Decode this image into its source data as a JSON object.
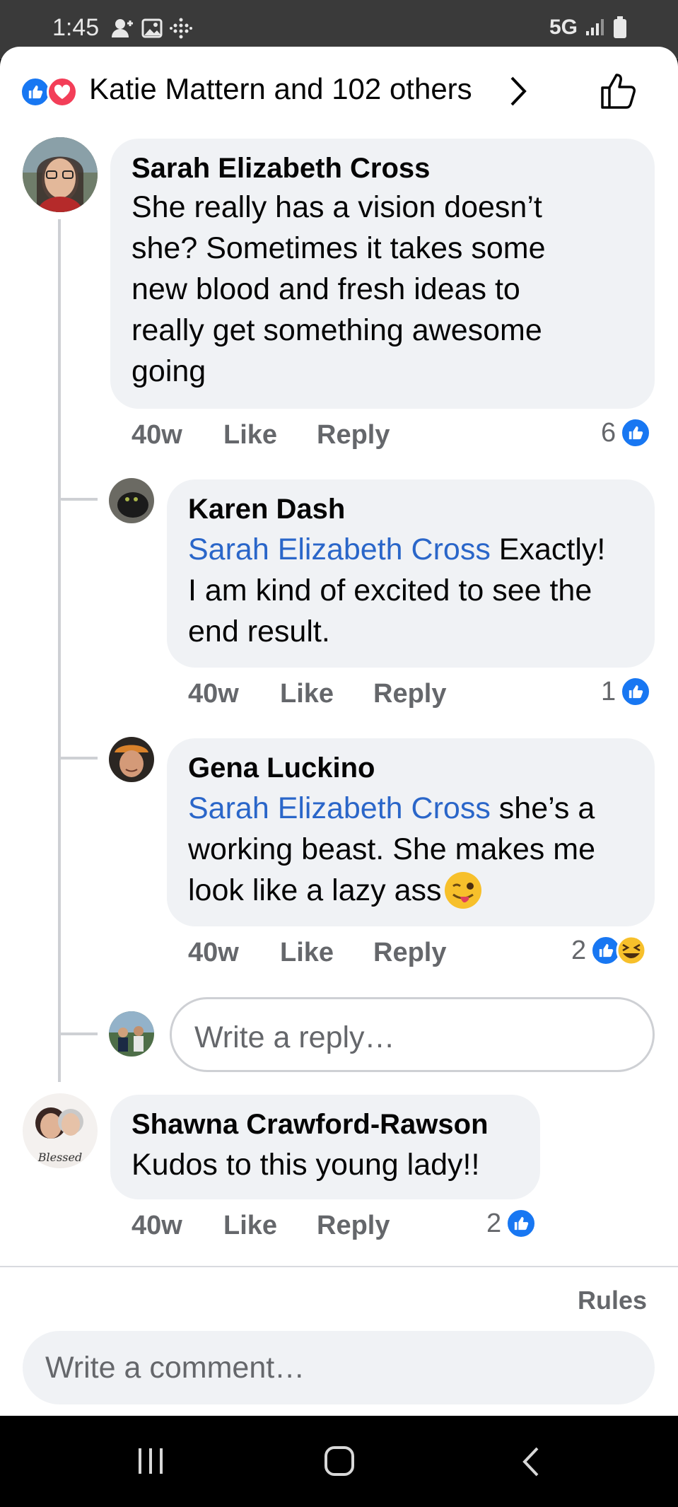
{
  "status_bar": {
    "time": "1:45",
    "network": "5G"
  },
  "header": {
    "reactions_text": "Katie Mattern and 102 others"
  },
  "comments": [
    {
      "name": "Sarah Elizabeth Cross",
      "lines": [
        "She really has a vision doesn’t",
        "she? Sometimes it takes some",
        "new blood and fresh ideas to",
        "really get something awesome",
        "going"
      ],
      "time": "40w",
      "like": "Like",
      "reply": "Reply",
      "reaction_count": "6"
    },
    {
      "name": "Karen Dash",
      "mention": "Sarah Elizabeth Cross",
      "lines": [
        " Exactly!",
        "I am kind of excited to see the",
        "end result."
      ],
      "time": "40w",
      "like": "Like",
      "reply": "Reply",
      "reaction_count": "1"
    },
    {
      "name": "Gena Luckino",
      "mention": "Sarah Elizabeth Cross",
      "lines": [
        " she’s a",
        "working beast. She makes me",
        "look like a lazy ass"
      ],
      "time": "40w",
      "like": "Like",
      "reply": "Reply",
      "reaction_count": "2"
    },
    {
      "name": "Shawna Crawford-Rawson",
      "lines": [
        "Kudos to this young lady!!"
      ],
      "time": "40w",
      "like": "Like",
      "reply": "Reply",
      "reaction_count": "2"
    }
  ],
  "reply_input": {
    "placeholder": "Write a reply…"
  },
  "footer": {
    "rules": "Rules",
    "comment_placeholder": "Write a comment…"
  },
  "colors": {
    "facebook_blue": "#1877f2",
    "mention": "#2a66c9",
    "bubble": "#f0f2f5",
    "muted": "#65676b"
  }
}
